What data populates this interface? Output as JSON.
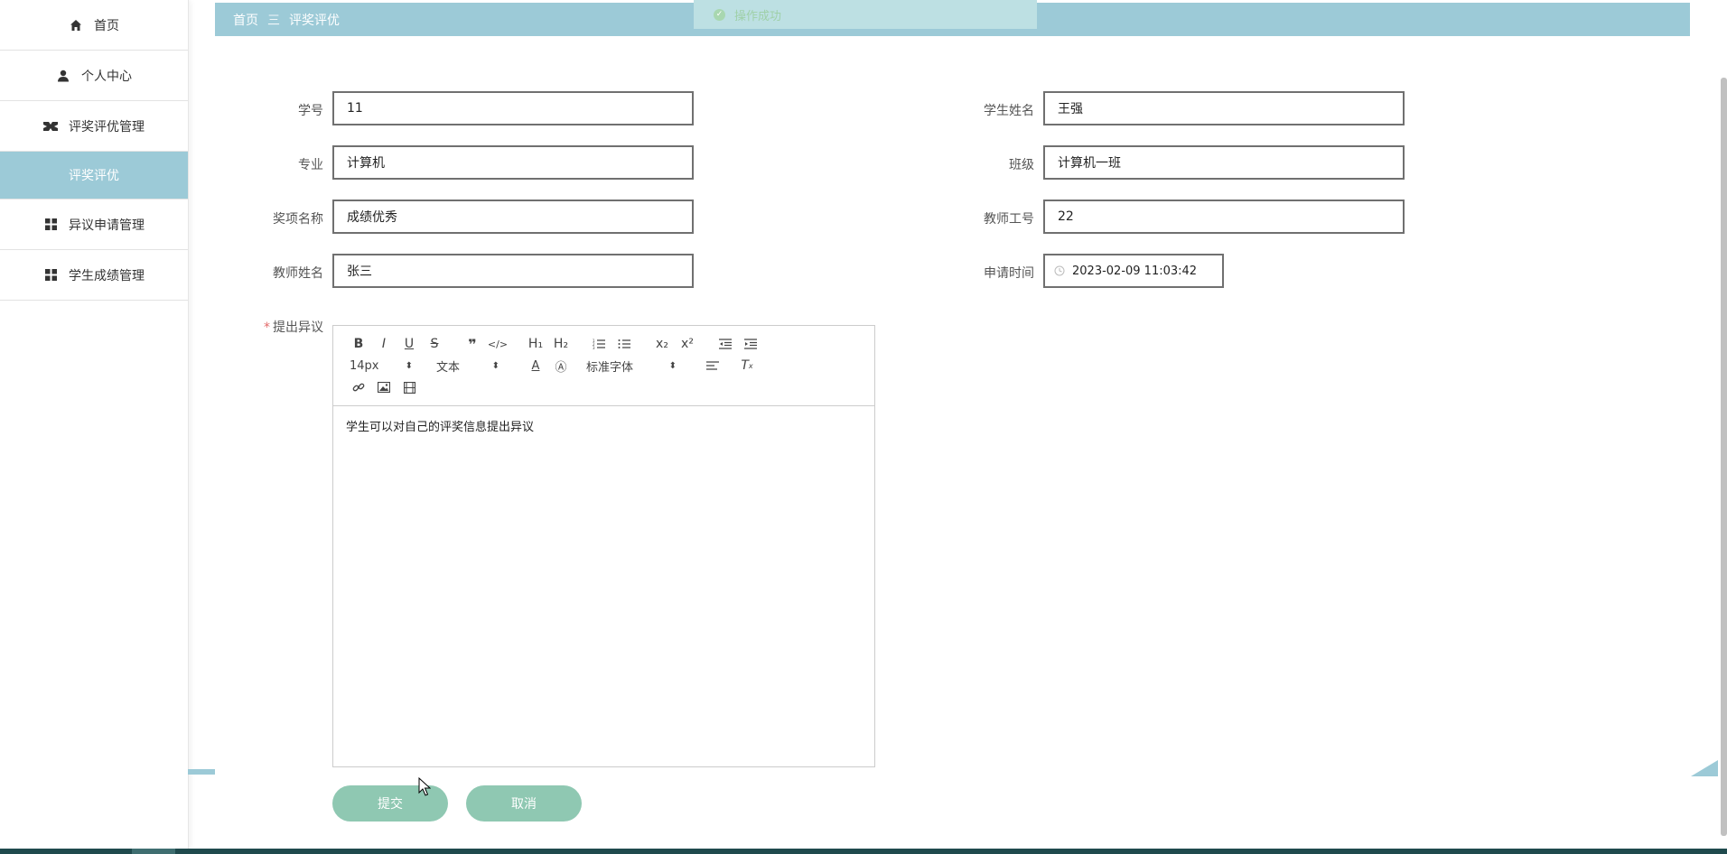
{
  "sidebar": {
    "items": [
      {
        "label": "首页",
        "icon": "home-icon"
      },
      {
        "label": "个人中心",
        "icon": "person-icon"
      },
      {
        "label": "评奖评优管理",
        "icon": "award-icon"
      },
      {
        "label": "评奖评优",
        "sub": true
      },
      {
        "label": "异议申请管理",
        "icon": "grid-icon"
      },
      {
        "label": "学生成绩管理",
        "icon": "grid-icon"
      }
    ]
  },
  "breadcrumb": {
    "home": "首页",
    "separator": "三",
    "current": "评奖评优"
  },
  "toast": {
    "text": "操作成功"
  },
  "form": {
    "student_id": {
      "label": "学号",
      "value": "11"
    },
    "student_name": {
      "label": "学生姓名",
      "value": "王强"
    },
    "major": {
      "label": "专业",
      "value": "计算机"
    },
    "class": {
      "label": "班级",
      "value": "计算机一班"
    },
    "award_name": {
      "label": "奖项名称",
      "value": "成绩优秀"
    },
    "teacher_id": {
      "label": "教师工号",
      "value": "22"
    },
    "teacher_name": {
      "label": "教师姓名",
      "value": "张三"
    },
    "apply_time": {
      "label": "申请时间",
      "value": "2023-02-09 11:03:42"
    },
    "objection": {
      "label": "提出异议",
      "required_mark": "*",
      "content": "学生可以对自己的评奖信息提出异议"
    }
  },
  "editor": {
    "toolbar": {
      "row1": [
        "B",
        "I",
        "U",
        "S",
        "❞",
        "</>",
        "H₁",
        "H₂",
        "ol",
        "ul",
        "x₂",
        "x²",
        "outdent",
        "indent"
      ],
      "size": "14px",
      "header": "文本",
      "font": "标准字体"
    }
  },
  "buttons": {
    "submit": "提交",
    "cancel": "取消"
  },
  "colors": {
    "accent": "#9ccad7",
    "button": "#8fc8b2"
  }
}
